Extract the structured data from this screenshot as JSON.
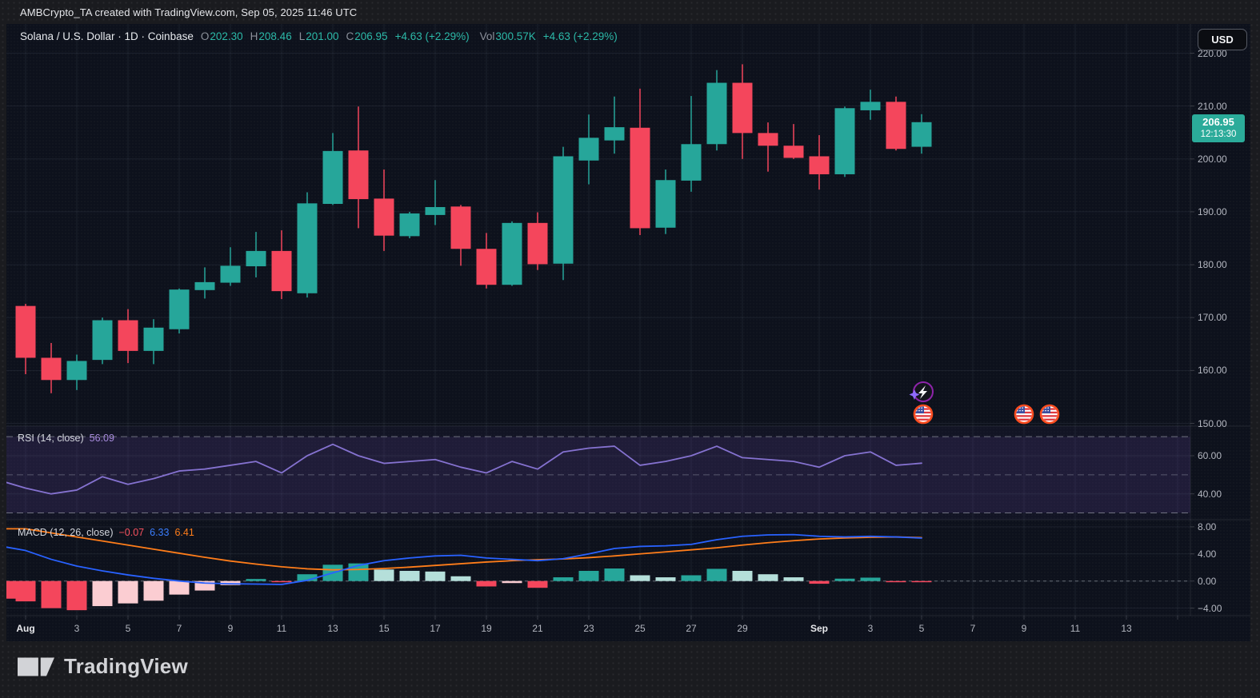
{
  "header": {
    "attribution": "AMBCrypto_TA created with TradingView.com, Sep 05, 2025 11:46 UTC"
  },
  "symbol_bar": {
    "title": "Solana / U.S. Dollar · 1D · Coinbase",
    "o_label": "O",
    "o": "202.30",
    "h_label": "H",
    "h": "208.46",
    "l_label": "L",
    "l": "201.00",
    "c_label": "C",
    "c": "206.95",
    "change": "+4.63 (+2.29%)",
    "vol_label": "Vol",
    "vol": "300.57K",
    "vol_change": "+4.63 (+2.29%)"
  },
  "axis": {
    "currency_button": "USD",
    "price_badge": {
      "price": "206.95",
      "countdown": "12:13:30"
    },
    "price_ticks": [
      {
        "label": "220.00",
        "v": 220
      },
      {
        "label": "210.00",
        "v": 210
      },
      {
        "label": "200.00",
        "v": 200
      },
      {
        "label": "190.00",
        "v": 190
      },
      {
        "label": "180.00",
        "v": 180
      },
      {
        "label": "170.00",
        "v": 170
      },
      {
        "label": "160.00",
        "v": 160
      },
      {
        "label": "150.00",
        "v": 150
      }
    ],
    "rsi_ticks": [
      {
        "label": "60.00",
        "v": 60
      },
      {
        "label": "40.00",
        "v": 40
      }
    ],
    "macd_ticks": [
      {
        "label": "8.00",
        "v": 8
      },
      {
        "label": "4.00",
        "v": 4
      },
      {
        "label": "0.00",
        "v": 0
      },
      {
        "label": "−4.00",
        "v": -4
      }
    ],
    "time_ticks": [
      {
        "label": "Aug",
        "i": 0,
        "bold": true
      },
      {
        "label": "3",
        "i": 2
      },
      {
        "label": "5",
        "i": 4
      },
      {
        "label": "7",
        "i": 6
      },
      {
        "label": "9",
        "i": 8
      },
      {
        "label": "11",
        "i": 10
      },
      {
        "label": "13",
        "i": 12
      },
      {
        "label": "15",
        "i": 14
      },
      {
        "label": "17",
        "i": 16
      },
      {
        "label": "19",
        "i": 18
      },
      {
        "label": "21",
        "i": 20
      },
      {
        "label": "23",
        "i": 22
      },
      {
        "label": "25",
        "i": 24
      },
      {
        "label": "27",
        "i": 26
      },
      {
        "label": "29",
        "i": 28
      },
      {
        "label": "Sep",
        "i": 31,
        "bold": true
      },
      {
        "label": "3",
        "i": 33
      },
      {
        "label": "5",
        "i": 35
      },
      {
        "label": "7",
        "i": 37
      },
      {
        "label": "9",
        "i": 39
      },
      {
        "label": "11",
        "i": 41
      },
      {
        "label": "13",
        "i": 43
      },
      {
        "label": "",
        "i": 45
      }
    ]
  },
  "panes": {
    "rsi": {
      "label": "RSI (14, close)",
      "value": "56.09",
      "bands": [
        70,
        50,
        30
      ]
    },
    "macd": {
      "label": "MACD (12, 26, close)",
      "hist_value": "−0.07",
      "macd_value": "6.33",
      "signal_value": "6.41"
    }
  },
  "icons": {
    "lightning": {
      "name": "lightning-event-icon",
      "i": 35
    },
    "flags": [
      {
        "name": "us-flag-event-icon",
        "i": 35
      },
      {
        "name": "us-flag-event-icon",
        "i": 39
      },
      {
        "name": "us-flag-event-icon",
        "i": 40
      }
    ]
  },
  "logo": {
    "text": "TradingView"
  },
  "colors": {
    "up": "#26a69a",
    "down": "#f4465c",
    "hist_pos_grow": "#26a69a",
    "hist_pos_fall": "#b5dfda",
    "hist_neg_fall": "#f4465c",
    "hist_neg_grow": "#fbcdd2",
    "macd_line": "#2962ff",
    "signal_line": "#ff7d1a",
    "rsi_line": "#8572d0",
    "badge_bg": "#2bab9a",
    "value_teal": "#2cb9a8",
    "value_red": "#f7525f",
    "value_blue": "#3b7eff",
    "value_orange": "#ff7d1a"
  },
  "chart_data": [
    {
      "type": "bar",
      "subtype": "candlestick",
      "title": "Solana / U.S. Dollar · 1D · Coinbase",
      "x": [
        "Aug 1",
        "Aug 2",
        "Aug 3",
        "Aug 4",
        "Aug 5",
        "Aug 6",
        "Aug 7",
        "Aug 8",
        "Aug 9",
        "Aug 10",
        "Aug 11",
        "Aug 12",
        "Aug 13",
        "Aug 14",
        "Aug 15",
        "Aug 16",
        "Aug 17",
        "Aug 18",
        "Aug 19",
        "Aug 20",
        "Aug 21",
        "Aug 22",
        "Aug 23",
        "Aug 24",
        "Aug 25",
        "Aug 26",
        "Aug 27",
        "Aug 28",
        "Aug 29",
        "Aug 30",
        "Aug 31",
        "Sep 1",
        "Sep 2",
        "Sep 3",
        "Sep 4",
        "Sep 5"
      ],
      "open": [
        172.2,
        162.4,
        158.2,
        162.0,
        169.5,
        163.7,
        167.8,
        175.2,
        176.6,
        179.7,
        182.6,
        174.6,
        191.5,
        201.6,
        192.5,
        185.4,
        189.4,
        191.0,
        183.0,
        176.2,
        187.9,
        180.2,
        199.7,
        203.5,
        205.9,
        187.0,
        195.9,
        202.8,
        214.4,
        204.9,
        202.5,
        200.5,
        197.1,
        209.2,
        210.8,
        202.3
      ],
      "high": [
        172.6,
        165.2,
        163.0,
        170.0,
        171.6,
        169.7,
        175.5,
        179.5,
        183.3,
        186.2,
        186.5,
        193.7,
        204.9,
        209.9,
        198.0,
        190.0,
        196.0,
        191.3,
        186.0,
        188.2,
        189.9,
        202.3,
        208.4,
        211.8,
        213.3,
        198.0,
        211.9,
        216.8,
        217.9,
        206.9,
        206.6,
        204.5,
        209.9,
        213.1,
        211.8,
        208.46
      ],
      "low": [
        159.3,
        155.7,
        156.3,
        161.2,
        161.4,
        161.2,
        167.0,
        173.6,
        176.0,
        177.6,
        173.5,
        173.8,
        191.3,
        186.9,
        182.6,
        185.0,
        187.5,
        179.8,
        175.5,
        176.0,
        179.0,
        177.1,
        195.2,
        201.0,
        185.6,
        185.8,
        193.8,
        201.6,
        200.0,
        197.6,
        200.0,
        194.2,
        196.6,
        207.4,
        201.6,
        201.0
      ],
      "close": [
        162.4,
        158.2,
        161.8,
        169.5,
        163.7,
        168.1,
        175.3,
        176.7,
        179.8,
        182.6,
        175.0,
        191.6,
        201.5,
        192.4,
        185.5,
        189.7,
        190.9,
        183.0,
        176.2,
        187.9,
        180.1,
        200.5,
        204.0,
        206.0,
        186.9,
        196.0,
        202.8,
        214.4,
        204.9,
        202.5,
        200.2,
        197.1,
        209.6,
        210.8,
        201.9,
        206.95
      ],
      "ylim": [
        148,
        222
      ],
      "grid": true,
      "legend_position": "none"
    },
    {
      "type": "line",
      "name": "RSI (14, close)",
      "values": [
        43,
        40,
        42,
        49,
        45,
        48,
        52,
        53,
        55,
        57,
        51,
        60,
        66,
        60,
        56,
        57,
        58,
        54,
        51,
        57,
        53,
        62,
        64,
        65,
        55,
        57,
        60,
        65,
        59,
        58,
        57,
        54,
        60,
        62,
        55,
        56.09
      ],
      "left_edge_value": 46,
      "last_value": 56.09,
      "band_levels": [
        70,
        50,
        30
      ],
      "ylim": [
        25,
        75
      ]
    },
    {
      "type": "line",
      "name": "MACD (12, 26, close)",
      "macd": [
        4.5,
        3.2,
        2.2,
        1.5,
        0.9,
        0.4,
        0.0,
        -0.3,
        -0.4,
        -0.45,
        -0.5,
        0.1,
        1.2,
        2.3,
        3.0,
        3.4,
        3.7,
        3.8,
        3.4,
        3.2,
        3.0,
        3.3,
        4.0,
        4.8,
        5.1,
        5.2,
        5.4,
        6.1,
        6.6,
        6.8,
        6.85,
        6.6,
        6.5,
        6.6,
        6.5,
        6.33
      ],
      "signal": [
        7.7,
        7.1,
        6.5,
        5.9,
        5.3,
        4.7,
        4.1,
        3.5,
        2.95,
        2.5,
        2.1,
        1.8,
        1.65,
        1.7,
        1.85,
        2.05,
        2.3,
        2.55,
        2.8,
        3.0,
        3.15,
        3.25,
        3.45,
        3.7,
        4.0,
        4.3,
        4.6,
        4.9,
        5.3,
        5.65,
        5.95,
        6.2,
        6.35,
        6.45,
        6.5,
        6.41
      ],
      "histogram": [
        -3.0,
        -4.0,
        -4.3,
        -3.7,
        -3.3,
        -2.9,
        -2.0,
        -1.4,
        -0.6,
        0.3,
        -0.1,
        1.0,
        2.4,
        2.6,
        1.7,
        1.5,
        1.4,
        0.7,
        -0.8,
        -0.3,
        -1.0,
        0.55,
        1.5,
        1.85,
        0.85,
        0.55,
        0.85,
        1.8,
        1.5,
        1.0,
        0.55,
        -0.4,
        0.35,
        0.5,
        -0.05,
        -0.07
      ],
      "left_edge": {
        "macd": 5.0,
        "signal": 7.7,
        "histogram": -2.6
      },
      "last": {
        "histogram": -0.07,
        "macd": 6.33,
        "signal": 6.41
      },
      "ylim": [
        -6,
        9
      ]
    }
  ]
}
